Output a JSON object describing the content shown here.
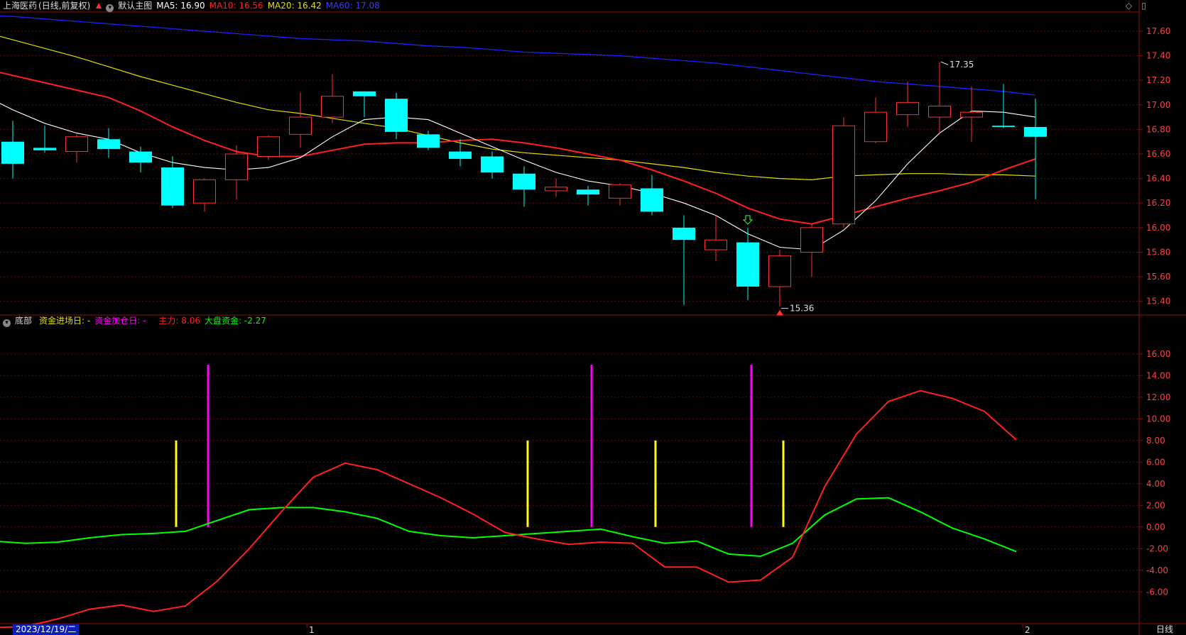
{
  "header": {
    "stock_name": "上海医药",
    "period_adjust": "(日线,前复权)",
    "template": "默认主图",
    "ma5": "MA5: 16.90",
    "ma10": "MA10: 16.56",
    "ma20": "MA20: 16.42",
    "ma60": "MA60: 17.08"
  },
  "indicator_header": {
    "name": "底部",
    "entry_day": "资金进场日: -",
    "add_day": "资金加仓日: -",
    "main_force": "主力: 8.06",
    "market_fund": "大盘资金: -2.27"
  },
  "footer": {
    "date": "2023/12/19/二",
    "month_1": "1",
    "month_2": "2",
    "period": "日线"
  },
  "colors": {
    "up": "#ff3030",
    "down": "#00ffff",
    "ma5": "#ffffff",
    "ma10": "#ff2020",
    "ma20": "#e0e000",
    "ma60": "#2020ff",
    "main_force": "#ff2020",
    "market_fund": "#00ff00",
    "entry": "#ffff00",
    "add": "#ff00ff"
  },
  "chart_data": [
    {
      "type": "candlestick",
      "ylim": [
        15.3,
        17.75
      ],
      "yticks": [
        "17.60",
        "17.40",
        "17.20",
        "17.00",
        "16.80",
        "16.60",
        "16.40",
        "16.20",
        "16.00",
        "15.80",
        "15.60",
        "15.40"
      ],
      "high_label": "17.35",
      "low_label": "15.36",
      "candles": [
        {
          "o": 16.7,
          "c": 16.52,
          "h": 16.87,
          "l": 16.4
        },
        {
          "o": 16.65,
          "c": 16.63,
          "h": 16.83,
          "l": 16.61
        },
        {
          "o": 16.62,
          "c": 16.74,
          "h": 16.76,
          "l": 16.53
        },
        {
          "o": 16.72,
          "c": 16.64,
          "h": 16.81,
          "l": 16.57
        },
        {
          "o": 16.62,
          "c": 16.53,
          "h": 16.66,
          "l": 16.45
        },
        {
          "o": 16.49,
          "c": 16.18,
          "h": 16.58,
          "l": 16.16
        },
        {
          "o": 16.2,
          "c": 16.39,
          "h": 16.4,
          "l": 16.13
        },
        {
          "o": 16.39,
          "c": 16.6,
          "h": 16.67,
          "l": 16.23
        },
        {
          "o": 16.58,
          "c": 16.74,
          "h": 16.75,
          "l": 16.55
        },
        {
          "o": 16.76,
          "c": 16.9,
          "h": 17.1,
          "l": 16.65
        },
        {
          "o": 16.9,
          "c": 17.07,
          "h": 17.25,
          "l": 16.85
        },
        {
          "o": 17.11,
          "c": 17.07,
          "h": 17.11,
          "l": 16.9
        },
        {
          "o": 17.05,
          "c": 16.78,
          "h": 17.1,
          "l": 16.72
        },
        {
          "o": 16.76,
          "c": 16.65,
          "h": 16.79,
          "l": 16.63
        },
        {
          "o": 16.62,
          "c": 16.56,
          "h": 16.72,
          "l": 16.5
        },
        {
          "o": 16.58,
          "c": 16.45,
          "h": 16.62,
          "l": 16.4
        },
        {
          "o": 16.44,
          "c": 16.31,
          "h": 16.5,
          "l": 16.17
        },
        {
          "o": 16.3,
          "c": 16.33,
          "h": 16.4,
          "l": 16.25
        },
        {
          "o": 16.31,
          "c": 16.27,
          "h": 16.34,
          "l": 16.18
        },
        {
          "o": 16.24,
          "c": 16.35,
          "h": 16.36,
          "l": 16.18
        },
        {
          "o": 16.32,
          "c": 16.13,
          "h": 16.43,
          "l": 16.1
        },
        {
          "o": 16.0,
          "c": 15.9,
          "h": 16.1,
          "l": 15.37
        },
        {
          "o": 15.82,
          "c": 15.9,
          "h": 16.1,
          "l": 15.73
        },
        {
          "o": 15.88,
          "c": 15.52,
          "h": 16.0,
          "l": 15.41
        },
        {
          "o": 15.52,
          "c": 15.77,
          "h": 15.82,
          "l": 15.36
        },
        {
          "o": 15.8,
          "c": 16.0,
          "h": 16.03,
          "l": 15.6
        },
        {
          "o": 16.03,
          "c": 16.83,
          "h": 16.9,
          "l": 16.0
        },
        {
          "o": 16.7,
          "c": 16.94,
          "h": 17.06,
          "l": 16.69
        },
        {
          "o": 16.92,
          "c": 17.02,
          "h": 17.19,
          "l": 16.82
        },
        {
          "o": 16.9,
          "c": 16.99,
          "h": 17.35,
          "l": 16.76
        },
        {
          "o": 16.9,
          "c": 16.94,
          "h": 17.15,
          "l": 16.7
        },
        {
          "o": 16.83,
          "c": 16.82,
          "h": 17.17,
          "l": 16.81
        },
        {
          "o": 16.82,
          "c": 16.74,
          "h": 17.05,
          "l": 16.23
        }
      ],
      "ma5": [
        17.09,
        16.96,
        16.85,
        16.77,
        16.72,
        16.61,
        16.53,
        16.49,
        16.47,
        16.49,
        16.57,
        16.74,
        16.88,
        16.9,
        16.88,
        16.77,
        16.66,
        16.55,
        16.45,
        16.38,
        16.34,
        16.28,
        16.2,
        16.1,
        15.95,
        15.84,
        15.82,
        15.98,
        16.22,
        16.52,
        16.77,
        16.95,
        16.94,
        16.9
      ],
      "ma10": [
        17.3,
        17.24,
        17.18,
        17.12,
        17.06,
        16.95,
        16.82,
        16.71,
        16.62,
        16.58,
        16.58,
        16.63,
        16.68,
        16.69,
        16.69,
        16.71,
        16.72,
        16.69,
        16.65,
        16.6,
        16.55,
        16.47,
        16.38,
        16.28,
        16.16,
        16.07,
        16.03,
        16.1,
        16.17,
        16.24,
        16.3,
        16.37,
        16.47,
        16.56
      ],
      "ma20": [
        17.6,
        17.53,
        17.46,
        17.39,
        17.31,
        17.23,
        17.16,
        17.09,
        17.02,
        16.96,
        16.93,
        16.89,
        16.85,
        16.81,
        16.75,
        16.69,
        16.64,
        16.61,
        16.59,
        16.57,
        16.55,
        16.52,
        16.49,
        16.45,
        16.42,
        16.4,
        16.39,
        16.42,
        16.43,
        16.44,
        16.44,
        16.43,
        16.43,
        16.42
      ],
      "ma60": [
        17.73,
        17.72,
        17.7,
        17.68,
        17.66,
        17.64,
        17.62,
        17.6,
        17.58,
        17.56,
        17.54,
        17.53,
        17.52,
        17.5,
        17.48,
        17.47,
        17.45,
        17.43,
        17.42,
        17.41,
        17.4,
        17.38,
        17.36,
        17.34,
        17.31,
        17.28,
        17.25,
        17.22,
        17.19,
        17.17,
        17.15,
        17.13,
        17.11,
        17.08
      ]
    },
    {
      "type": "line",
      "title": "底部",
      "ylim": [
        -9.0,
        17.5
      ],
      "yticks": [
        "16.00",
        "14.00",
        "12.00",
        "10.00",
        "8.00",
        "6.00",
        "4.00",
        "2.00",
        "0.00",
        "-2.00",
        "-4.00",
        "-6.00"
      ],
      "series": [
        {
          "name": "主力",
          "values": [
            -9.3,
            -9.2,
            -8.5,
            -7.6,
            -7.2,
            -7.8,
            -7.3,
            -5.0,
            -2.0,
            1.4,
            4.6,
            5.9,
            5.3,
            4.0,
            2.7,
            1.2,
            -0.5,
            -1.1,
            -1.6,
            -1.4,
            -1.5,
            -3.7,
            -3.7,
            -5.1,
            -4.9,
            -2.8,
            3.7,
            8.6,
            11.6,
            12.6,
            11.9,
            10.7,
            8.06
          ]
        },
        {
          "name": "大盘资金",
          "values": [
            -1.3,
            -1.5,
            -1.4,
            -1.0,
            -0.7,
            -0.6,
            -0.4,
            0.6,
            1.6,
            1.8,
            1.8,
            1.4,
            0.8,
            -0.4,
            -0.8,
            -1.0,
            -0.8,
            -0.6,
            -0.4,
            -0.2,
            -0.9,
            -1.5,
            -1.3,
            -2.5,
            -2.7,
            -1.5,
            1.1,
            2.6,
            2.7,
            1.4,
            -0.1,
            -1.1,
            -2.27
          ]
        }
      ],
      "entry_bars": {
        "name": "资金进场日",
        "indices": [
          5,
          16,
          20,
          24
        ],
        "value": 8.0
      },
      "add_bars": {
        "name": "资金加仓日",
        "indices": [
          6,
          18,
          23
        ],
        "value": 15.0
      }
    }
  ]
}
